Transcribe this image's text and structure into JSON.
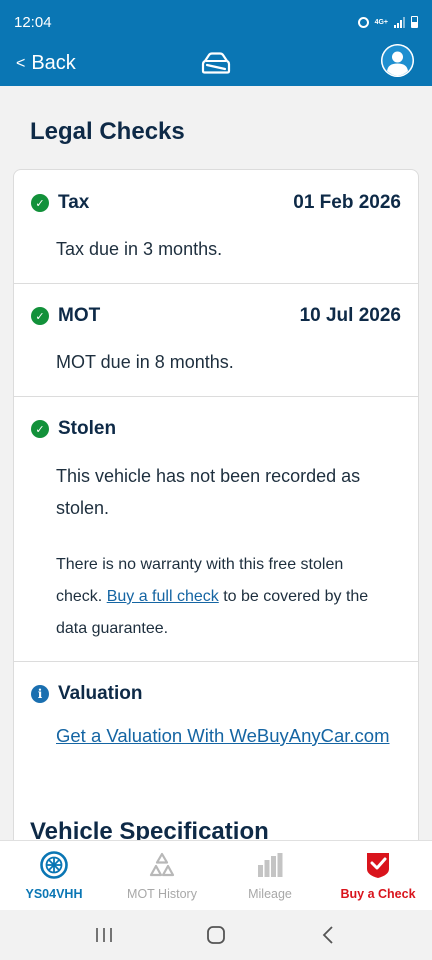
{
  "status_bar": {
    "time": "12:04",
    "network": "4G+"
  },
  "header": {
    "back_label": "Back",
    "back_chevron": "<"
  },
  "section_title": "Legal Checks",
  "next_section_title": "Vehicle Specification",
  "checks": {
    "tax": {
      "icon": "check-circle-icon",
      "title": "Tax",
      "date": "01 Feb 2026",
      "detail": "Tax due in 3 months."
    },
    "mot": {
      "icon": "check-circle-icon",
      "title": "MOT",
      "date": "10 Jul 2026",
      "detail": "MOT due in 8 months."
    },
    "stolen": {
      "icon": "check-circle-icon",
      "title": "Stolen",
      "detail": "This vehicle has not been recorded as stolen.",
      "note_before": "There is no warranty with this free stolen check. ",
      "note_link": "Buy a full check",
      "note_after": " to be covered by the data guarantee."
    },
    "valuation": {
      "icon": "info-circle-icon",
      "title": "Valuation",
      "link": "Get a Valuation With WeBuyAnyCar.com"
    }
  },
  "bottom_nav": [
    {
      "label": "YS04VHH",
      "icon": "wheel-icon",
      "state": "active"
    },
    {
      "label": "MOT History",
      "icon": "mot-history-icon",
      "state": "muted"
    },
    {
      "label": "Mileage",
      "icon": "mileage-icon",
      "state": "muted"
    },
    {
      "label": "Buy a Check",
      "icon": "buy-check-icon",
      "state": "buy"
    }
  ],
  "colors": {
    "brand": "#0a76b4",
    "check_green": "#12913a",
    "info_blue": "#1a6fb0",
    "buy_red": "#d9141c",
    "text_dark": "#0e2a47"
  }
}
